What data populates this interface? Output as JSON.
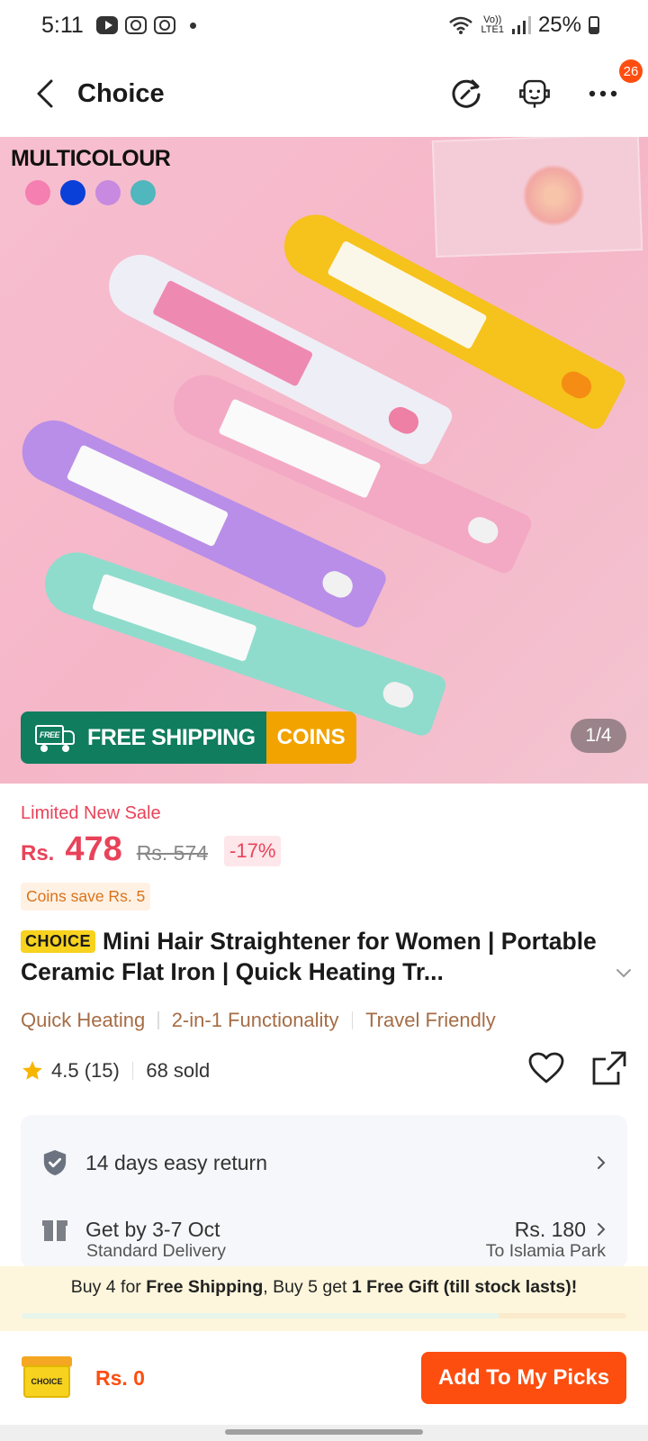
{
  "status_bar": {
    "time": "5:11",
    "net_top": "Vo))",
    "net_bottom": "LTE1",
    "battery": "25%"
  },
  "nav": {
    "title": "Choice",
    "cart_badge": "26"
  },
  "hero": {
    "variant_label": "MULTICOLOUR",
    "swatch_colors": [
      "#f47fb0",
      "#0a3fd8",
      "#c78ae0",
      "#4fb7bd"
    ],
    "free_badge": "FREE",
    "shipping_label": "FREE SHIPPING",
    "coins_label": "COINS",
    "pager": "1/4"
  },
  "product": {
    "sale_label": "Limited New Sale",
    "currency": "Rs.",
    "price": "478",
    "old_price": "Rs. 574",
    "discount": "-17%",
    "coins_save": "Coins save Rs. 5",
    "choice_badge": "CHOICE",
    "title": "Mini Hair Straightener for Women | Portable Ceramic Flat Iron | Quick Heating Tr...",
    "features": [
      "Quick Heating",
      "2-in-1 Functionality",
      "Travel Friendly"
    ],
    "rating": "4.5 (15)",
    "sold": "68 sold"
  },
  "service": {
    "return_text": "14 days easy return",
    "delivery_text": "Get by 3-7 Oct",
    "delivery_price": "Rs. 180",
    "delivery_type": "Standard Delivery",
    "delivery_to": "To Islamia Park"
  },
  "promo": {
    "part1": "Buy 4 for ",
    "part1_bold": "Free Shipping",
    "part2": ", Buy 5 get ",
    "part2_bold": "1 Free Gift (till stock lasts)!",
    "progress": 0.79
  },
  "bottom": {
    "cart_label": "CHOICE",
    "cart_total": "Rs. 0",
    "add_button": "Add To My Picks"
  },
  "colors": {
    "accent": "#fd4e10",
    "price": "#e8435a",
    "shipping_green": "#0f7d5e",
    "coins_orange": "#f2a300"
  }
}
